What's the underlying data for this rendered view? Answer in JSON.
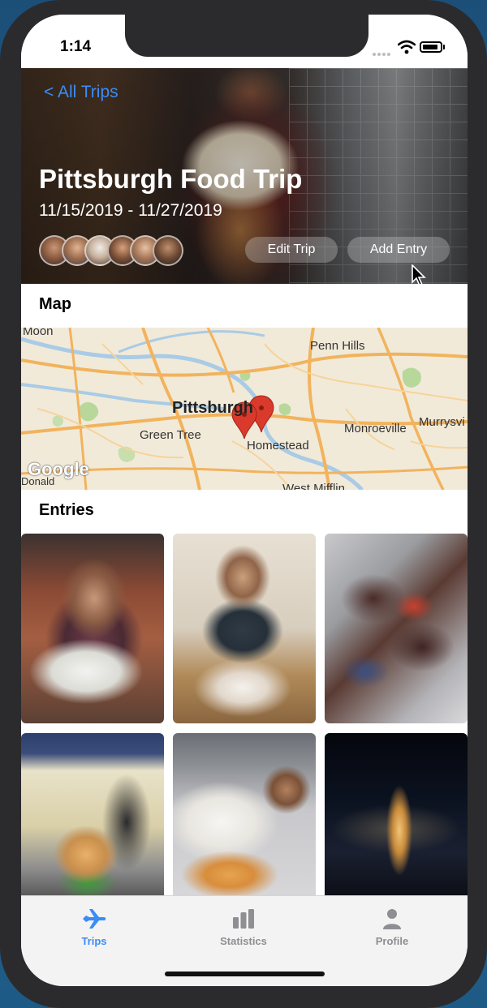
{
  "status_bar": {
    "time": "1:14"
  },
  "header": {
    "back_label": "< All Trips",
    "trip_title": "Pittsburgh Food Trip",
    "trip_dates": "11/15/2019 - 11/27/2019",
    "edit_button": "Edit Trip",
    "add_entry_button": "Add Entry"
  },
  "map_section": {
    "title": "Map",
    "place_labels": [
      "Moon",
      "Penn Hills",
      "Pittsburgh",
      "Green Tree",
      "Homestead",
      "Monroeville",
      "Murrysvi",
      "Donald",
      "West Mifflin"
    ],
    "attribution": "Google"
  },
  "entries_section": {
    "title": "Entries",
    "entries": [
      {
        "kind": "photo",
        "subject": "person-at-restaurant"
      },
      {
        "kind": "photo",
        "subject": "person-with-pizza"
      },
      {
        "kind": "photo",
        "subject": "brownies-tray"
      },
      {
        "kind": "photo",
        "subject": "ice-cream-shop"
      },
      {
        "kind": "photo",
        "subject": "pizza-table"
      },
      {
        "kind": "photo",
        "subject": "christmas-tree-night"
      }
    ]
  },
  "tab_bar": {
    "items": [
      {
        "label": "Trips",
        "icon": "airplane-icon",
        "active": true
      },
      {
        "label": "Statistics",
        "icon": "bar-chart-icon",
        "active": false
      },
      {
        "label": "Profile",
        "icon": "person-icon",
        "active": false
      }
    ]
  },
  "colors": {
    "accent": "#3b8cf5",
    "tab_inactive": "#8e8e93",
    "map_land": "#f1ead9",
    "map_road": "#f2b35d",
    "map_pin": "#d93a2b"
  }
}
